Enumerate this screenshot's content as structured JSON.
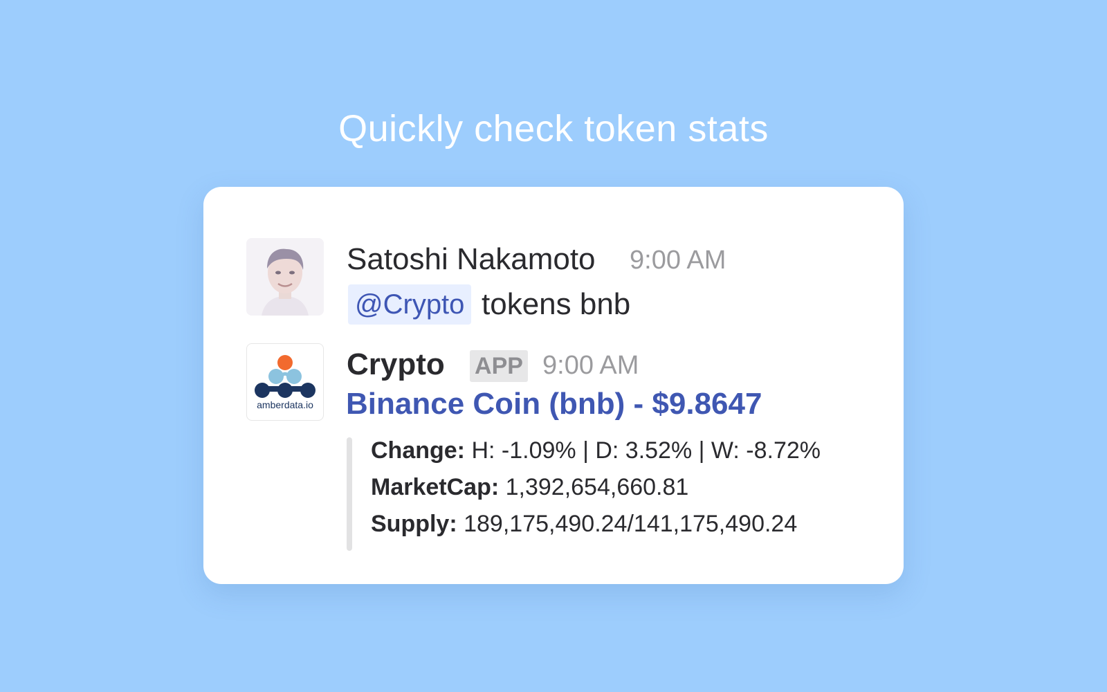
{
  "headline": "Quickly check token stats",
  "user_message": {
    "author": "Satoshi Nakamoto",
    "time": "9:00 AM",
    "mention": "@Crypto",
    "text": "tokens bnb",
    "avatar_icon": "user-avatar-photo"
  },
  "bot_message": {
    "author": "Crypto",
    "badge": "APP",
    "time": "9:00 AM",
    "avatar_icon": "amberdata-logo",
    "logo_text": "amberdata.io",
    "title": "Binance Coin (bnb) - $9.8647",
    "stats": [
      {
        "label": "Change:",
        "value": " H: -1.09% | D: 3.52% | W: -8.72%"
      },
      {
        "label": "MarketCap:",
        "value": " 1,392,654,660.81"
      },
      {
        "label": "Supply:",
        "value": " 189,175,490.24/141,175,490.24"
      }
    ]
  },
  "colors": {
    "background": "#9dcdfd",
    "link_blue": "#3f57b2",
    "mention_bg": "#e8efff",
    "logo_orange": "#f26a2e",
    "logo_light_blue": "#8cc3df",
    "logo_navy": "#1c3560"
  }
}
